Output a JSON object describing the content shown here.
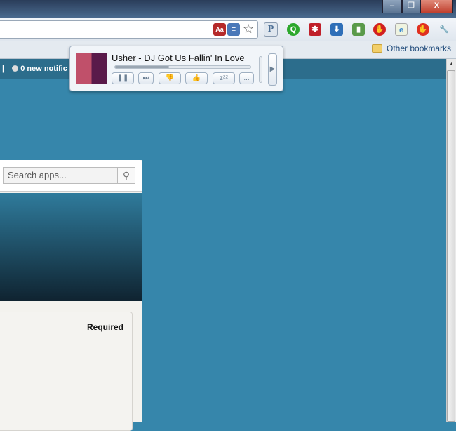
{
  "window": {
    "minimize": "–",
    "restore": "❐",
    "close": "X"
  },
  "toolbar": {
    "extensions": [
      {
        "name": "dictionary",
        "glyph": "Aa",
        "color": "#b52a2a"
      },
      {
        "name": "translate",
        "glyph": "≡",
        "color": "#4a78b8"
      },
      {
        "name": "pandora",
        "glyph": "P",
        "color": "#4d6f95"
      },
      {
        "name": "q-extension",
        "glyph": "Q",
        "color": "#2da82d"
      },
      {
        "name": "asterisk",
        "glyph": "✱",
        "color": "#c0202a"
      },
      {
        "name": "download",
        "glyph": "⬇",
        "color": "#2f6fb8"
      },
      {
        "name": "device",
        "glyph": "▮",
        "color": "#5a9a4a"
      },
      {
        "name": "stop",
        "glyph": "✋",
        "color": "#d22020"
      },
      {
        "name": "ie-tab",
        "glyph": "e",
        "color": "#3a8ad0"
      },
      {
        "name": "adblock",
        "glyph": "✋",
        "color": "#e03020"
      },
      {
        "name": "wrench",
        "glyph": "🔧",
        "color": "#444444"
      }
    ]
  },
  "bookmarks": {
    "other": "Other bookmarks"
  },
  "page": {
    "separator": "|",
    "notifications": "0 new notific",
    "search_placeholder": "Search apps...",
    "required": "Required"
  },
  "player": {
    "track": "Usher - DJ Got Us Fallin' In Love",
    "progress": 0.4,
    "volume": 0.85,
    "buttons": {
      "pause": "❚❚",
      "skip": "⏭",
      "dislike": "👎",
      "like": "👍",
      "sleep": "zᶻᶻ",
      "more": "..."
    }
  }
}
